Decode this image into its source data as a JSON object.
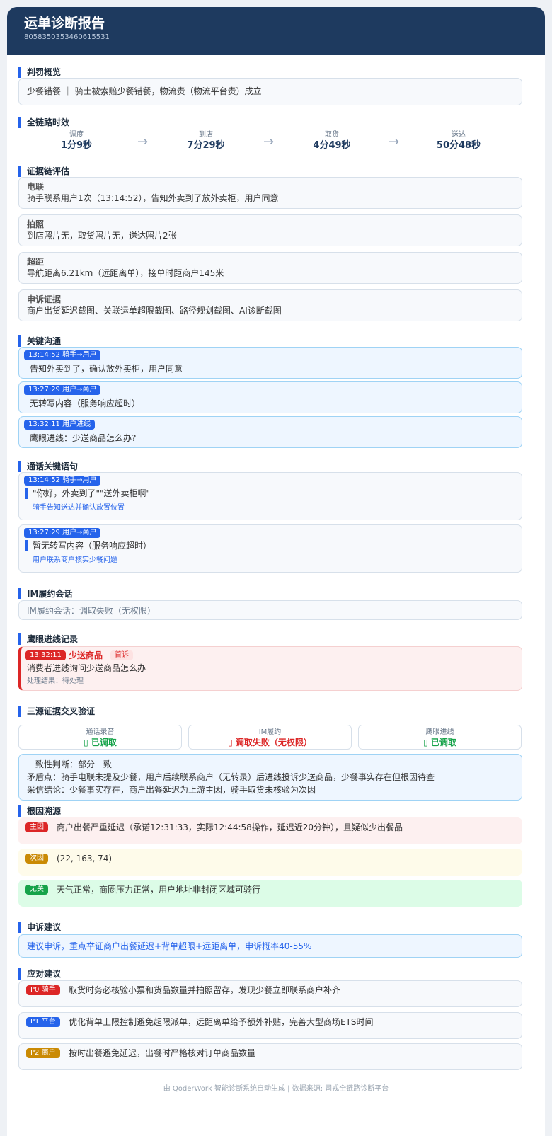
{
  "header": {
    "title": "运单诊断报告",
    "order_id": "8058350353460615531"
  },
  "sections": {
    "penalty": "判罚概览",
    "timing": "全链路时效",
    "evidence": "证据链评估",
    "key_comm": "关键沟通",
    "call_quotes": "通话关键语句",
    "im": "IM履约会话",
    "eagle": "鹰眼进线记录",
    "cross": "三源证据交叉验证",
    "root": "根因溯源",
    "appeal": "申诉建议",
    "response": "应对建议"
  },
  "penalty": {
    "text": "少餐错餐 ｜ 骑士被索赔少餐错餐，物流责（物流平台责）成立"
  },
  "timeline": [
    {
      "label": "调度",
      "value": "1分9秒"
    },
    {
      "label": "到店",
      "value": "7分29秒"
    },
    {
      "label": "取货",
      "value": "4分49秒"
    },
    {
      "label": "送达",
      "value": "50分48秒"
    }
  ],
  "timeline_arrow": "→",
  "evidence": [
    {
      "title": "电联",
      "text": "骑手联系用户1次（13:14:52），告知外卖到了放外卖柜，用户同意"
    },
    {
      "title": "拍照",
      "text": "到店照片无，取货照片无，送达照片2张"
    },
    {
      "title": "超距",
      "text": "导航距离6.21km（远距离单），接单时距商户145米"
    },
    {
      "title": "申诉证据",
      "text": "商户出货延迟截图、关联运单超限截图、路径规划截图、AI诊断截图"
    }
  ],
  "key_comm": [
    {
      "tag": "13:14:52  骑手→用户",
      "text": "告知外卖到了，确认放外卖柜，用户同意"
    },
    {
      "tag": "13:27:29  用户→商户",
      "text": "无转写内容（服务响应超时）"
    },
    {
      "tag": "13:32:11  用户进线",
      "text": "鹰眼进线：少送商品怎么办?"
    }
  ],
  "call_quotes": [
    {
      "tag": "13:14:52  骑手→用户",
      "quote": "\"你好，外卖到了\"\"送外卖柜啊\"",
      "note": "骑手告知送达并确认放置位置"
    },
    {
      "tag": "13:27:29  用户→商户",
      "quote": "暂无转写内容（服务响应超时）",
      "note": "用户联系商户核实少餐问题"
    }
  ],
  "im": {
    "text": "IM履约会话：调取失败（无权限）"
  },
  "eagle": {
    "time": "13:32:11",
    "type": "少送商品",
    "badge": "首诉",
    "desc": "消费者进线询问少送商品怎么办",
    "result": "处理结果：待处理"
  },
  "cross": {
    "sources": [
      {
        "label": "通话录音",
        "value": "▯ 已调取",
        "color": "#16a34a"
      },
      {
        "label": "IM履约",
        "value": "▯ 调取失败（无权限）",
        "color": "#dc2626"
      },
      {
        "label": "鹰眼进线",
        "value": "▯ 已调取",
        "color": "#16a34a"
      }
    ],
    "consistency": "一致性判断：部分一致",
    "conflict": "矛盾点：骑手电联未提及少餐，用户后续联系商户（无转录）后进线投诉少送商品，少餐事实存在但根因待查",
    "conclusion": "采信结论：少餐事实存在，商户出餐延迟为上游主因，骑手取货未核验为次因"
  },
  "root": [
    {
      "tag": "主因",
      "text": "商户出餐严重延迟（承诺12:31:33，实际12:44:58操作，延迟近20分钟），且疑似少出餐品",
      "bg": "#fdf0f0",
      "tagColor": "#dc2626"
    },
    {
      "tag": "次因",
      "text": "(22, 163, 74)",
      "bg": "#fefbea",
      "tagColor": "#ca8a04"
    },
    {
      "tag": "无关",
      "text": "天气正常，商圈压力正常，用户地址非封闭区域可骑行",
      "bg": "#dcfce7",
      "tagColor": "#16a34a"
    }
  ],
  "appeal": {
    "text": "建议申诉，重点举证商户出餐延迟+背单超限+远距离单，申诉概率40-55%"
  },
  "response": [
    {
      "tag": "P0 骑手",
      "text": "取货时务必核验小票和货品数量并拍照留存，发现少餐立即联系商户补齐",
      "tagColor": "#dc2626"
    },
    {
      "tag": "P1 平台",
      "text": "优化背单上限控制避免超限派单，远距离单给予额外补贴，完善大型商场ETS时间",
      "tagColor": "#2563eb"
    },
    {
      "tag": "P2 商户",
      "text": "按时出餐避免延迟，出餐时严格核对订单商品数量",
      "tagColor": "#ca8a04"
    }
  ],
  "footer": "由 QoderWork 智能诊断系统自动生成 | 数据来源: 司戎全链路诊断平台"
}
